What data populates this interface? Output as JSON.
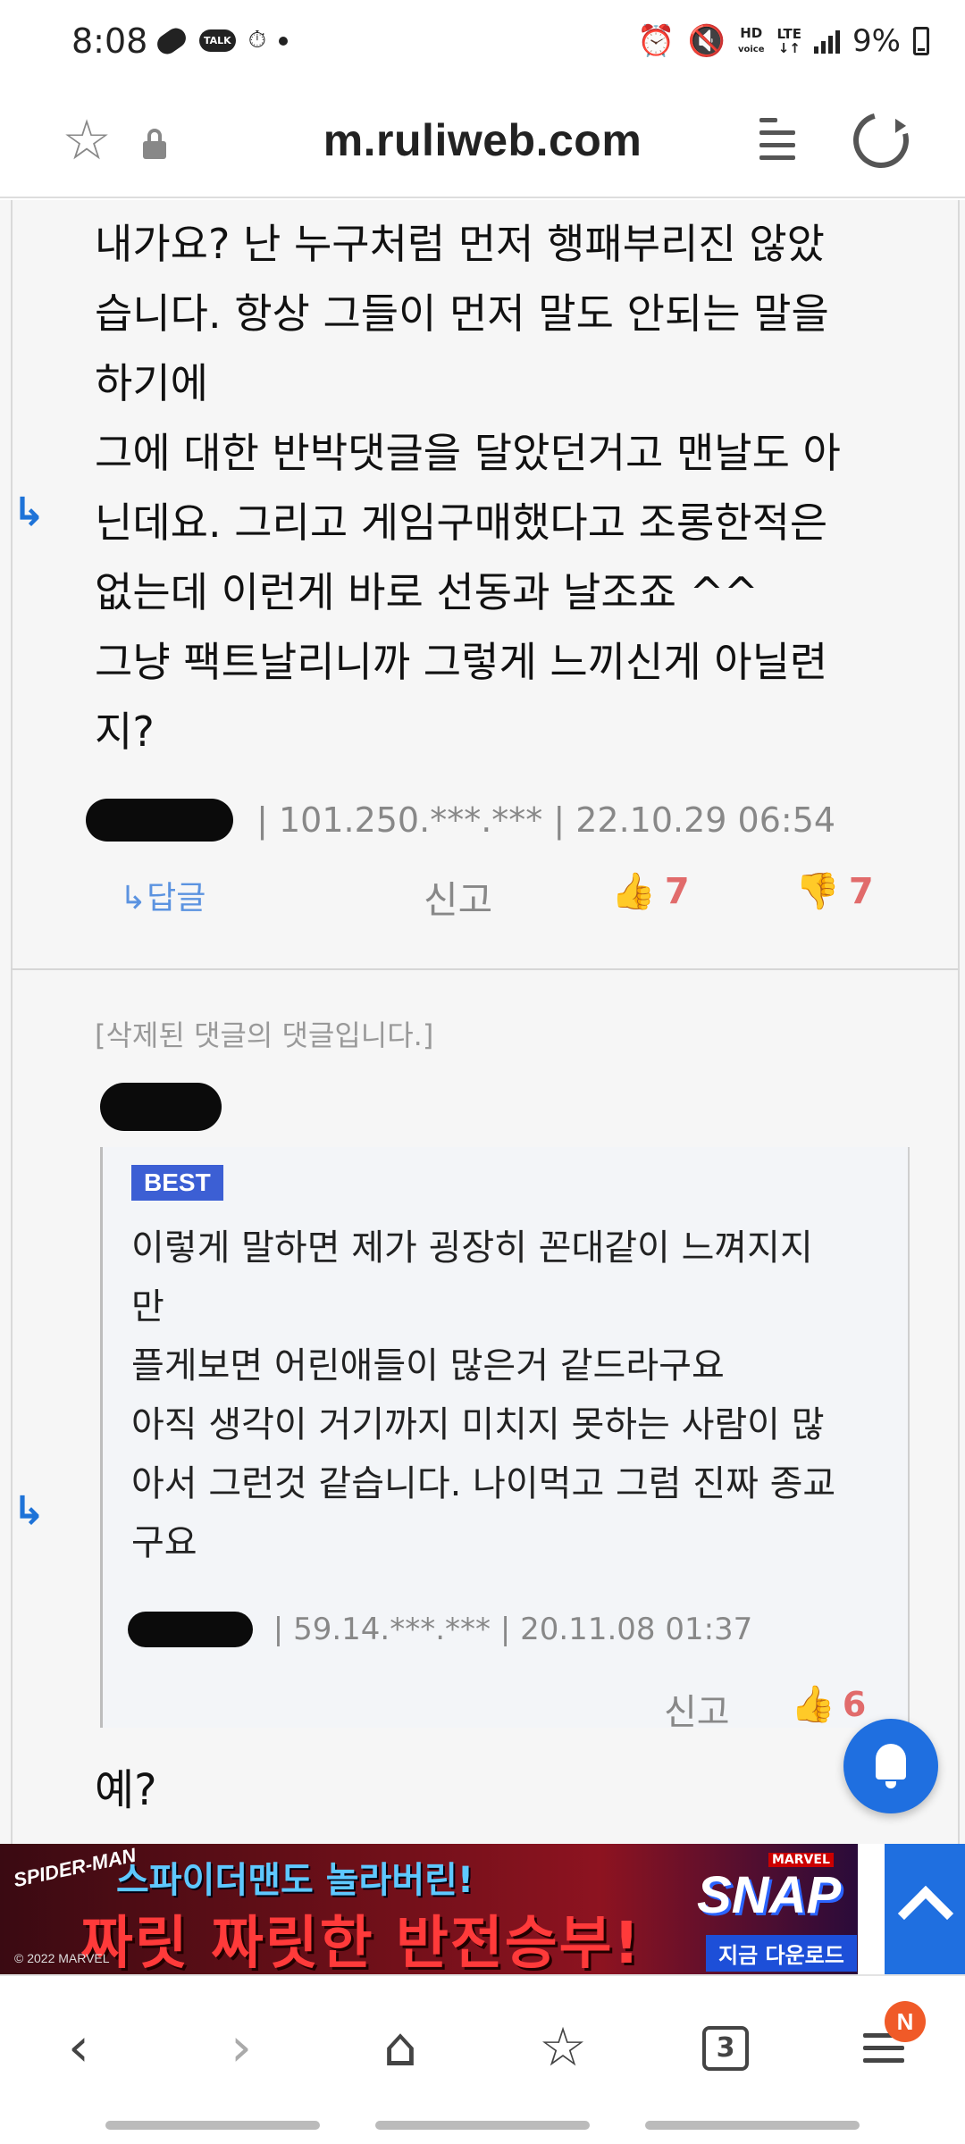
{
  "status_bar": {
    "time": "8:08",
    "talk_icon_label": "TALK",
    "hd_label": "HD",
    "voice_label": "voice",
    "lte_label": "LTE",
    "battery": "9%"
  },
  "address_bar": {
    "url": "m.ruliweb.com"
  },
  "comment1": {
    "text": "내가요? 난 누구처럼 먼저 행패부리진 않았\n습니다. 항상 그들이 먼저 말도 안되는 말을\n하기에\n그에 대한 반박댓글을 달았던거고 맨날도 아\n닌데요. 그리고 게임구매했다고 조롱한적은\n없는데 이런게 바로 선동과 날조죠 ^^\n그냥 팩트날리니까 그렇게 느끼신게 아닐련\n지?",
    "ip": "101.250.***.***",
    "datetime": "22.10.29 06:54",
    "reply_label": "↳답글",
    "report_label": "신고",
    "likes": "7",
    "dislikes": "7"
  },
  "comment2": {
    "deleted_note": "[삭제된 댓글의 댓글입니다.]",
    "quote": {
      "badge": "BEST",
      "text": "이렇게 말하면 제가 굉장히 꼰대같이 느껴지지\n만\n플게보면 어린애들이 많은거 같드라구요\n아직 생각이 거기까지 미치지 못하는 사람이 많\n아서 그런것 같습니다. 나이먹고 그럼 진짜 종교\n구요",
      "ip": "59.14.***.***",
      "datetime": "20.11.08 01:37",
      "report_label": "신고",
      "likes": "6"
    },
    "answer": "예?"
  },
  "banner_ad": {
    "spidey": "SPIDER-MAN",
    "line1": "스파이더맨도 놀라버린!",
    "line2": "짜릿 짜릿한 반전승부!",
    "brand_top": "MARVEL",
    "brand": "SNAP",
    "download": "지금 다운로드",
    "copyright": "© 2022 MARVEL"
  },
  "bottom_nav": {
    "tab_count": "3",
    "menu_badge": "N"
  },
  "colors": {
    "accent_blue": "#1f6fe0",
    "like_red": "#e16b6b",
    "best_badge": "#3c5fd4"
  }
}
